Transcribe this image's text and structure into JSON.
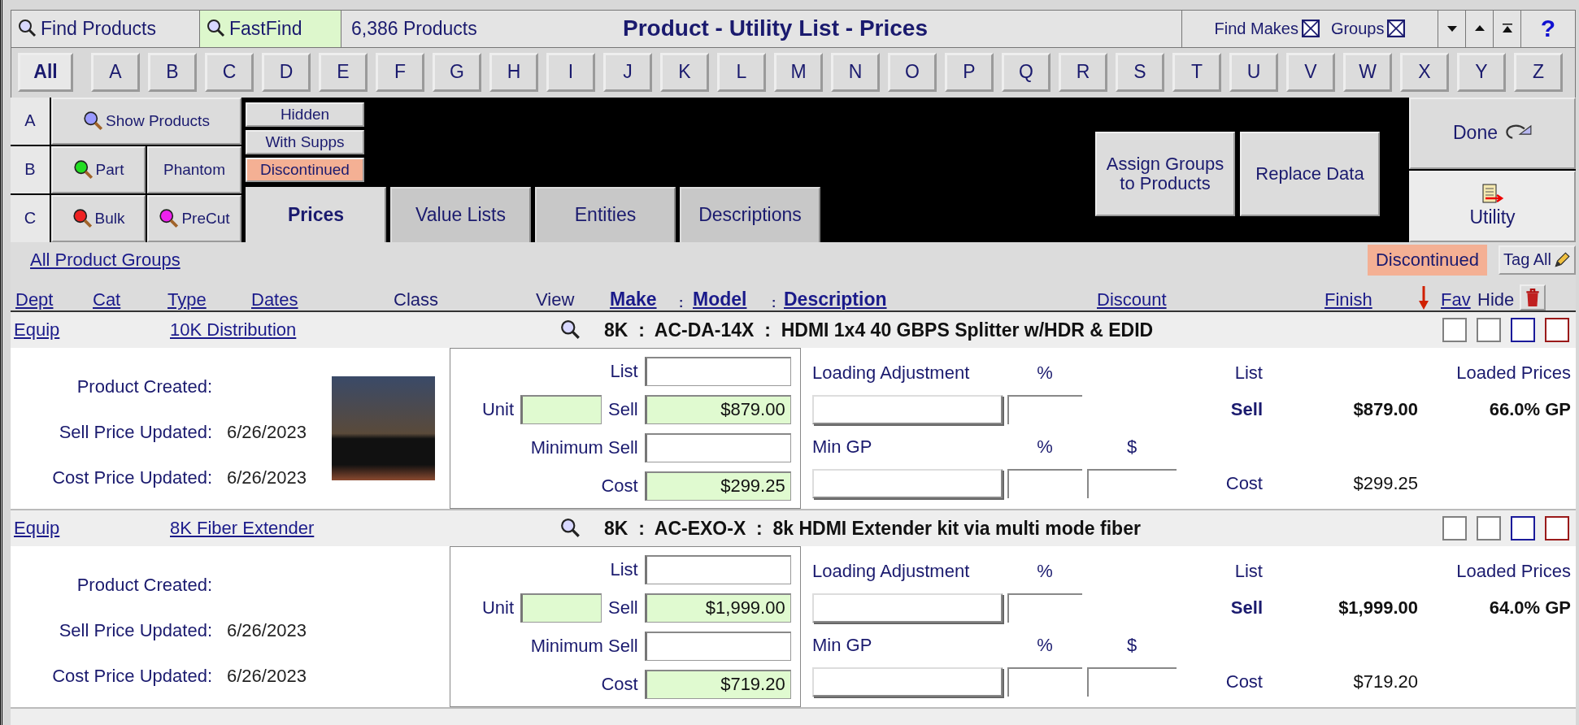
{
  "toolbar": {
    "find_products": "Find Products",
    "fastfind": "FastFind",
    "count": "6,386 Products",
    "title": "Product - Utility List - Prices",
    "toggles": [
      {
        "label": "Find Makes",
        "checked": true
      },
      {
        "label": "Groups",
        "checked": true
      }
    ],
    "help": "?"
  },
  "letters": [
    {
      "label": "All",
      "selected": true
    },
    {
      "label": "A",
      "selected": false
    },
    {
      "label": "B",
      "selected": false
    },
    {
      "label": "C",
      "selected": false
    },
    {
      "label": "D",
      "selected": false
    },
    {
      "label": "E",
      "selected": false
    },
    {
      "label": "F",
      "selected": false
    },
    {
      "label": "G",
      "selected": false
    },
    {
      "label": "H",
      "selected": false
    },
    {
      "label": "I",
      "selected": false
    },
    {
      "label": "J",
      "selected": false
    },
    {
      "label": "K",
      "selected": false
    },
    {
      "label": "L",
      "selected": false
    },
    {
      "label": "M",
      "selected": false
    },
    {
      "label": "N",
      "selected": false
    },
    {
      "label": "O",
      "selected": false
    },
    {
      "label": "P",
      "selected": false
    },
    {
      "label": "Q",
      "selected": false
    },
    {
      "label": "R",
      "selected": false
    },
    {
      "label": "S",
      "selected": false
    },
    {
      "label": "T",
      "selected": false
    },
    {
      "label": "U",
      "selected": false
    },
    {
      "label": "V",
      "selected": false
    },
    {
      "label": "W",
      "selected": false
    },
    {
      "label": "X",
      "selected": false
    },
    {
      "label": "Y",
      "selected": false
    },
    {
      "label": "Z",
      "selected": false
    }
  ],
  "finders": [
    {
      "letter": "A",
      "buttons": [
        {
          "label": "Show Products",
          "color": "#9a9aff"
        }
      ]
    },
    {
      "letter": "B",
      "buttons": [
        {
          "label": "Part",
          "color": "#22dd22"
        },
        {
          "label": "Phantom"
        }
      ]
    },
    {
      "letter": "C",
      "buttons": [
        {
          "label": "Bulk",
          "color": "#ee2222"
        },
        {
          "label": "PreCut",
          "color": "#ee22ee"
        }
      ]
    }
  ],
  "filters": [
    {
      "label": "Hidden",
      "on": false
    },
    {
      "label": "With Supps",
      "on": false
    },
    {
      "label": "Discontinued",
      "on": true
    }
  ],
  "tabs": [
    {
      "label": "Prices",
      "selected": true
    },
    {
      "label": "Value Lists",
      "selected": false
    },
    {
      "label": "Entities",
      "selected": false
    },
    {
      "label": "Descriptions",
      "selected": false
    }
  ],
  "actions": [
    "Assign Groups to Products",
    "Replace Data"
  ],
  "done": "Done",
  "utility": "Utility",
  "header": {
    "all_groups": "All Product Groups",
    "discontinued": "Discontinued",
    "tag_all": "Tag All",
    "columns": [
      {
        "label": "Dept",
        "kind": "link"
      },
      {
        "label": "Cat",
        "kind": "link"
      },
      {
        "label": "Type",
        "kind": "link"
      },
      {
        "label": "Dates",
        "kind": "link"
      },
      {
        "label": "Class",
        "kind": "plain"
      },
      {
        "label": "View",
        "kind": "plain"
      },
      {
        "label": "Make",
        "kind": "bold"
      },
      {
        "label": ":",
        "kind": "sep"
      },
      {
        "label": "Model",
        "kind": "bold"
      },
      {
        "label": ":",
        "kind": "sep"
      },
      {
        "label": "Description",
        "kind": "bold"
      },
      {
        "label": "Discount",
        "kind": "link"
      },
      {
        "label": "Finish",
        "kind": "link"
      },
      {
        "kind": "arrow"
      },
      {
        "label": "Fav",
        "kind": "link"
      },
      {
        "label": "Hide",
        "kind": "plain"
      },
      {
        "kind": "trash"
      }
    ]
  },
  "products": [
    {
      "dept": "Equip",
      "group": "10K Distribution",
      "title": "8K  :  AC-DA-14X  :  HDMI 1x4 40 GBPS Splitter w/HDR & EDID",
      "photo": true,
      "flags": [
        {
          "checked": false,
          "color": "#808080"
        },
        {
          "checked": false,
          "color": "#808080"
        },
        {
          "checked": false,
          "color": "#1a1a9a"
        },
        {
          "checked": false,
          "color": "#9a1a1a"
        }
      ],
      "dates": [
        {
          "label": "Product Created:"
        },
        {
          "label": "Sell Price Updated:",
          "value": "6/26/2023"
        },
        {
          "label": "Cost Price Updated:",
          "value": "6/26/2023"
        }
      ],
      "prices": {
        "list_label": "List",
        "unit_label": "Unit",
        "sell_label": "Sell",
        "min_label": "Minimum Sell",
        "cost_label": "Cost",
        "sell": "$879.00",
        "cost": "$299.25"
      },
      "loading": {
        "label": "Loading Adjustment",
        "pct": "%",
        "min_gp": "Min GP",
        "pct2": "%",
        "dollar": "$"
      },
      "summary": {
        "list_label": "List",
        "loaded_label": "Loaded Prices",
        "sell_label": "Sell",
        "sell": "$879.00",
        "gp": "66.0% GP",
        "cost_label": "Cost",
        "cost": "$299.25"
      }
    },
    {
      "dept": "Equip",
      "group": "8K Fiber Extender",
      "title": "8K  :  AC-EXO-X  :  8k HDMI Extender kit via multi mode fiber",
      "photo": false,
      "flags": [
        {
          "checked": false,
          "color": "#808080"
        },
        {
          "checked": false,
          "color": "#808080"
        },
        {
          "checked": false,
          "color": "#1a1a9a"
        },
        {
          "checked": false,
          "color": "#9a1a1a"
        }
      ],
      "dates": [
        {
          "label": "Product Created:"
        },
        {
          "label": "Sell Price Updated:",
          "value": "6/26/2023"
        },
        {
          "label": "Cost Price Updated:",
          "value": "6/26/2023"
        }
      ],
      "prices": {
        "list_label": "List",
        "unit_label": "Unit",
        "sell_label": "Sell",
        "min_label": "Minimum Sell",
        "cost_label": "Cost",
        "sell": "$1,999.00",
        "cost": "$719.20"
      },
      "loading": {
        "label": "Loading Adjustment",
        "pct": "%",
        "min_gp": "Min GP",
        "pct2": "%",
        "dollar": "$"
      },
      "summary": {
        "list_label": "List",
        "loaded_label": "Loaded Prices",
        "sell_label": "Sell",
        "sell": "$1,999.00",
        "gp": "64.0% GP",
        "cost_label": "Cost",
        "cost": "$719.20"
      }
    }
  ]
}
